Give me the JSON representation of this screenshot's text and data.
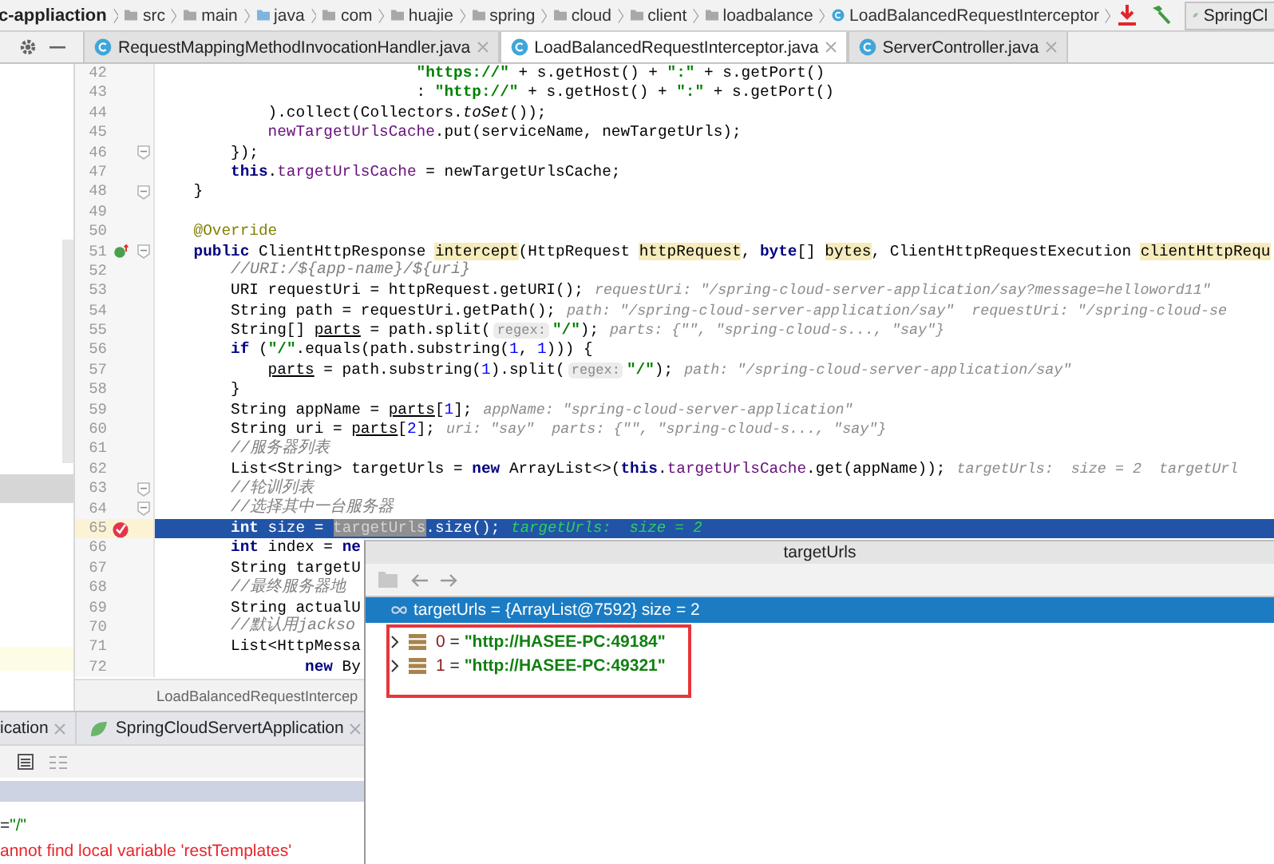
{
  "breadcrumbs": {
    "project": "c-appliaction",
    "items": [
      {
        "kind": "folder",
        "label": "src"
      },
      {
        "kind": "folder",
        "label": "main"
      },
      {
        "kind": "source_folder",
        "label": "java"
      },
      {
        "kind": "folder",
        "label": "com"
      },
      {
        "kind": "folder",
        "label": "huajie"
      },
      {
        "kind": "folder",
        "label": "spring"
      },
      {
        "kind": "folder",
        "label": "cloud"
      },
      {
        "kind": "folder",
        "label": "client"
      },
      {
        "kind": "folder",
        "label": "loadbalance"
      },
      {
        "kind": "class",
        "label": "LoadBalancedRequestInterceptor"
      }
    ]
  },
  "run_config": "SpringCl",
  "tabs": [
    {
      "label": "RequestMappingMethodInvocationHandler.java",
      "selected": false
    },
    {
      "label": "LoadBalancedRequestInterceptor.java",
      "selected": true
    },
    {
      "label": "ServerController.java",
      "selected": false
    }
  ],
  "editor": {
    "lines": [
      {
        "number": "42",
        "kind": "plain",
        "fold": false,
        "current": false,
        "segments": [
          {
            "kind": "code",
            "tokens": [
              {
                "kind": "string",
                "text": "                            \"https://\""
              },
              {
                "kind": "plain",
                "text": " + s.getHost() + "
              },
              {
                "kind": "string",
                "text": "\":\""
              },
              {
                "kind": "plain",
                "text": " + s.getPort()"
              }
            ]
          }
        ]
      },
      {
        "number": "43",
        "kind": "plain",
        "fold": false,
        "current": false,
        "segments": [
          {
            "kind": "code",
            "tokens": [
              {
                "kind": "plain",
                "text": "                            : "
              },
              {
                "kind": "string",
                "text": "\"http://\""
              },
              {
                "kind": "plain",
                "text": " + s.getHost() + "
              },
              {
                "kind": "string",
                "text": "\":\""
              },
              {
                "kind": "plain",
                "text": " + s.getPort()"
              }
            ]
          }
        ]
      },
      {
        "number": "44",
        "kind": "plain",
        "fold": false,
        "current": false,
        "segments": [
          {
            "kind": "code",
            "tokens": [
              {
                "kind": "plain",
                "text": "            ).collect(Collectors."
              },
              {
                "kind": "static",
                "text": "toSet"
              },
              {
                "kind": "plain",
                "text": "());"
              }
            ]
          }
        ]
      },
      {
        "number": "45",
        "kind": "plain",
        "fold": false,
        "current": false,
        "segments": [
          {
            "kind": "code",
            "tokens": [
              {
                "kind": "field",
                "text": "            newTargetUrlsCache"
              },
              {
                "kind": "plain",
                "text": ".put(serviceName, newTargetUrls);"
              }
            ]
          }
        ]
      },
      {
        "number": "46",
        "kind": "plain",
        "fold": true,
        "current": false,
        "segments": [
          {
            "kind": "code",
            "tokens": [
              {
                "kind": "plain",
                "text": "        });"
              }
            ]
          }
        ]
      },
      {
        "number": "47",
        "kind": "plain",
        "fold": false,
        "current": false,
        "segments": [
          {
            "kind": "code",
            "tokens": [
              {
                "kind": "keyword",
                "text": "        this"
              },
              {
                "kind": "plain",
                "text": "."
              },
              {
                "kind": "field",
                "text": "targetUrlsCache"
              },
              {
                "kind": "plain",
                "text": " = newTargetUrlsCache;"
              }
            ]
          }
        ]
      },
      {
        "number": "48",
        "kind": "plain",
        "fold": true,
        "current": false,
        "segments": [
          {
            "kind": "code",
            "tokens": [
              {
                "kind": "plain",
                "text": "    }"
              }
            ]
          }
        ]
      },
      {
        "number": "49",
        "kind": "plain",
        "fold": false,
        "current": false
      },
      {
        "number": "50",
        "kind": "plain",
        "fold": false,
        "current": false,
        "segments": [
          {
            "kind": "code",
            "tokens": [
              {
                "kind": "annotation",
                "text": "    @Override"
              }
            ]
          }
        ]
      },
      {
        "number": "51",
        "kind": "override",
        "fold": true,
        "current": false,
        "segments": [
          {
            "kind": "code",
            "tokens": [
              {
                "kind": "keyword",
                "text": "    public"
              },
              {
                "kind": "plain",
                "text": " ClientHttpResponse "
              },
              {
                "kind": "highlight",
                "text": "intercept"
              },
              {
                "kind": "plain",
                "text": "(HttpRequest "
              },
              {
                "kind": "highlight",
                "text": "httpRequest"
              },
              {
                "kind": "plain",
                "text": ", "
              },
              {
                "kind": "keyword",
                "text": "byte"
              },
              {
                "kind": "plain",
                "text": "[] "
              },
              {
                "kind": "highlight",
                "text": "bytes"
              },
              {
                "kind": "plain",
                "text": ", ClientHttpRequestExecution "
              },
              {
                "kind": "highlight",
                "text": "clientHttpRequ"
              }
            ]
          }
        ]
      },
      {
        "number": "52",
        "kind": "plain",
        "fold": false,
        "current": false,
        "segments": [
          {
            "kind": "code",
            "tokens": [
              {
                "kind": "comment",
                "text": "        //URI:/${app-name}/${uri}"
              }
            ]
          }
        ]
      },
      {
        "number": "53",
        "kind": "plain",
        "fold": false,
        "current": false,
        "segments": [
          {
            "kind": "code",
            "tokens": [
              {
                "kind": "plain",
                "text": "        URI requestUri = httpRequest.getURI();"
              }
            ]
          },
          {
            "kind": "value_hint",
            "text": "requestUri: \"/spring-cloud-server-application/say?message=helloword11\""
          }
        ]
      },
      {
        "number": "54",
        "kind": "plain",
        "fold": false,
        "current": false,
        "segments": [
          {
            "kind": "code",
            "tokens": [
              {
                "kind": "plain",
                "text": "        String path = requestUri.getPath();"
              }
            ]
          },
          {
            "kind": "value_hint",
            "text": "path: \"/spring-cloud-server-application/say\"  requestUri: \"/spring-cloud-se"
          }
        ]
      },
      {
        "number": "55",
        "kind": "plain",
        "fold": false,
        "current": false,
        "segments": [
          {
            "kind": "code",
            "tokens": [
              {
                "kind": "plain",
                "text": "        String[] "
              },
              {
                "kind": "underline",
                "text": "parts"
              },
              {
                "kind": "plain",
                "text": " = path.split("
              }
            ]
          },
          {
            "kind": "param_hint",
            "text": "regex:"
          },
          {
            "kind": "code",
            "tokens": [
              {
                "kind": "string",
                "text": "\"/\""
              },
              {
                "kind": "plain",
                "text": ");"
              }
            ]
          },
          {
            "kind": "value_hint",
            "text": "parts: {\"\", \"spring-cloud-s..., \"say\"}"
          }
        ]
      },
      {
        "number": "56",
        "kind": "plain",
        "fold": false,
        "current": false,
        "segments": [
          {
            "kind": "code",
            "tokens": [
              {
                "kind": "keyword",
                "text": "        if"
              },
              {
                "kind": "plain",
                "text": " ("
              },
              {
                "kind": "string",
                "text": "\"/\""
              },
              {
                "kind": "plain",
                "text": ".equals(path.substring("
              },
              {
                "kind": "number",
                "text": "1"
              },
              {
                "kind": "plain",
                "text": ", "
              },
              {
                "kind": "number",
                "text": "1"
              },
              {
                "kind": "plain",
                "text": "))) {"
              }
            ]
          }
        ]
      },
      {
        "number": "57",
        "kind": "plain",
        "fold": false,
        "current": false,
        "segments": [
          {
            "kind": "code",
            "tokens": [
              {
                "kind": "underline",
                "text": "            parts"
              },
              {
                "kind": "plain",
                "text": " = path.substring("
              },
              {
                "kind": "number",
                "text": "1"
              },
              {
                "kind": "plain",
                "text": ").split("
              }
            ]
          },
          {
            "kind": "param_hint",
            "text": "regex:"
          },
          {
            "kind": "code",
            "tokens": [
              {
                "kind": "string",
                "text": "\"/\""
              },
              {
                "kind": "plain",
                "text": ");"
              }
            ]
          },
          {
            "kind": "value_hint",
            "text": "path: \"/spring-cloud-server-application/say\""
          }
        ]
      },
      {
        "number": "58",
        "kind": "plain",
        "fold": false,
        "current": false,
        "segments": [
          {
            "kind": "code",
            "tokens": [
              {
                "kind": "plain",
                "text": "        }"
              }
            ]
          }
        ]
      },
      {
        "number": "59",
        "kind": "plain",
        "fold": false,
        "current": false,
        "segments": [
          {
            "kind": "code",
            "tokens": [
              {
                "kind": "plain",
                "text": "        String appName = "
              },
              {
                "kind": "underline",
                "text": "parts"
              },
              {
                "kind": "plain",
                "text": "["
              },
              {
                "kind": "number",
                "text": "1"
              },
              {
                "kind": "plain",
                "text": "];"
              }
            ]
          },
          {
            "kind": "value_hint",
            "text": "appName: \"spring-cloud-server-application\""
          }
        ]
      },
      {
        "number": "60",
        "kind": "plain",
        "fold": false,
        "current": false,
        "segments": [
          {
            "kind": "code",
            "tokens": [
              {
                "kind": "plain",
                "text": "        String uri = "
              },
              {
                "kind": "underline",
                "text": "parts"
              },
              {
                "kind": "plain",
                "text": "["
              },
              {
                "kind": "number",
                "text": "2"
              },
              {
                "kind": "plain",
                "text": "];"
              }
            ]
          },
          {
            "kind": "value_hint",
            "text": "uri: \"say\"  parts: {\"\", \"spring-cloud-s..., \"say\"}"
          }
        ]
      },
      {
        "number": "61",
        "kind": "plain",
        "fold": false,
        "current": false,
        "segments": [
          {
            "kind": "code",
            "tokens": [
              {
                "kind": "comment",
                "text": "        //服务器列表"
              }
            ]
          }
        ]
      },
      {
        "number": "62",
        "kind": "plain",
        "fold": false,
        "current": false,
        "segments": [
          {
            "kind": "code",
            "tokens": [
              {
                "kind": "plain",
                "text": "        List<String> targetUrls = "
              },
              {
                "kind": "keyword",
                "text": "new"
              },
              {
                "kind": "plain",
                "text": " ArrayList<>("
              },
              {
                "kind": "keyword",
                "text": "this"
              },
              {
                "kind": "plain",
                "text": "."
              },
              {
                "kind": "field",
                "text": "targetUrlsCache"
              },
              {
                "kind": "plain",
                "text": ".get(appName));"
              }
            ]
          },
          {
            "kind": "value_hint",
            "text": "targetUrls:  size = 2  targetUrl"
          }
        ]
      },
      {
        "number": "63",
        "kind": "plain",
        "fold": true,
        "current": false,
        "segments": [
          {
            "kind": "code",
            "tokens": [
              {
                "kind": "comment",
                "text": "        //轮训列表"
              }
            ]
          }
        ]
      },
      {
        "number": "64",
        "kind": "plain",
        "fold": true,
        "current": false,
        "segments": [
          {
            "kind": "code",
            "tokens": [
              {
                "kind": "comment",
                "text": "        //选择其中一台服务器"
              }
            ]
          }
        ]
      },
      {
        "number": "65",
        "kind": "breakpoint",
        "fold": false,
        "current": true,
        "segments": [
          {
            "kind": "code",
            "tokens": [
              {
                "kind": "keyword",
                "text": "        int"
              },
              {
                "kind": "plain",
                "text": " size = "
              },
              {
                "kind": "selection",
                "text": "targetUrls"
              },
              {
                "kind": "plain",
                "text": ".size();"
              }
            ]
          },
          {
            "kind": "debug_value",
            "text": "targetUrls:  size = 2"
          }
        ]
      },
      {
        "number": "66",
        "kind": "plain",
        "fold": false,
        "current": false,
        "segments": [
          {
            "kind": "code",
            "tokens": [
              {
                "kind": "keyword",
                "text": "        int"
              },
              {
                "kind": "plain",
                "text": " index = "
              },
              {
                "kind": "keyword",
                "text": "ne"
              }
            ]
          }
        ]
      },
      {
        "number": "67",
        "kind": "plain",
        "fold": false,
        "current": false,
        "segments": [
          {
            "kind": "code",
            "tokens": [
              {
                "kind": "plain",
                "text": "        String targetU"
              }
            ]
          }
        ]
      },
      {
        "number": "68",
        "kind": "plain",
        "fold": false,
        "current": false,
        "segments": [
          {
            "kind": "code",
            "tokens": [
              {
                "kind": "comment",
                "text": "        //最终服务器地"
              }
            ]
          }
        ]
      },
      {
        "number": "69",
        "kind": "plain",
        "fold": false,
        "current": false,
        "segments": [
          {
            "kind": "code",
            "tokens": [
              {
                "kind": "plain",
                "text": "        String actualU"
              }
            ]
          }
        ]
      },
      {
        "number": "70",
        "kind": "plain",
        "fold": false,
        "current": false,
        "segments": [
          {
            "kind": "code",
            "tokens": [
              {
                "kind": "comment",
                "text": "        //默认用jackso"
              }
            ]
          }
        ]
      },
      {
        "number": "71",
        "kind": "plain",
        "fold": false,
        "current": false,
        "segments": [
          {
            "kind": "code",
            "tokens": [
              {
                "kind": "plain",
                "text": "        List<HttpMessa"
              }
            ]
          }
        ]
      },
      {
        "number": "72",
        "kind": "plain",
        "fold": false,
        "current": false,
        "segments": [
          {
            "kind": "code",
            "tokens": [
              {
                "kind": "keyword",
                "text": "                new"
              },
              {
                "kind": "plain",
                "text": " By"
              }
            ]
          }
        ]
      }
    ],
    "breadcrumb": "LoadBalancedRequestIntercep"
  },
  "popup": {
    "title": "targetUrls",
    "root": {
      "text": "targetUrls = {ArrayList@7592}  size = 2",
      "selected": true
    },
    "items": [
      {
        "name": "0",
        "operator": "=",
        "value": "\"http://HASEE-PC:49184\"",
        "expanded": false
      },
      {
        "name": "1",
        "operator": "=",
        "value": "\"http://HASEE-PC:49321\"",
        "expanded": false
      }
    ]
  },
  "run_window": {
    "tabs": [
      {
        "label": "ication",
        "selected": false
      },
      {
        "label": "SpringCloudServertApplication",
        "selected": false
      }
    ],
    "output": [
      {
        "kind": "result",
        "operator": "=",
        "value": "\"/\""
      },
      {
        "kind": "error",
        "text": "annot find local variable 'restTemplates'"
      }
    ]
  }
}
